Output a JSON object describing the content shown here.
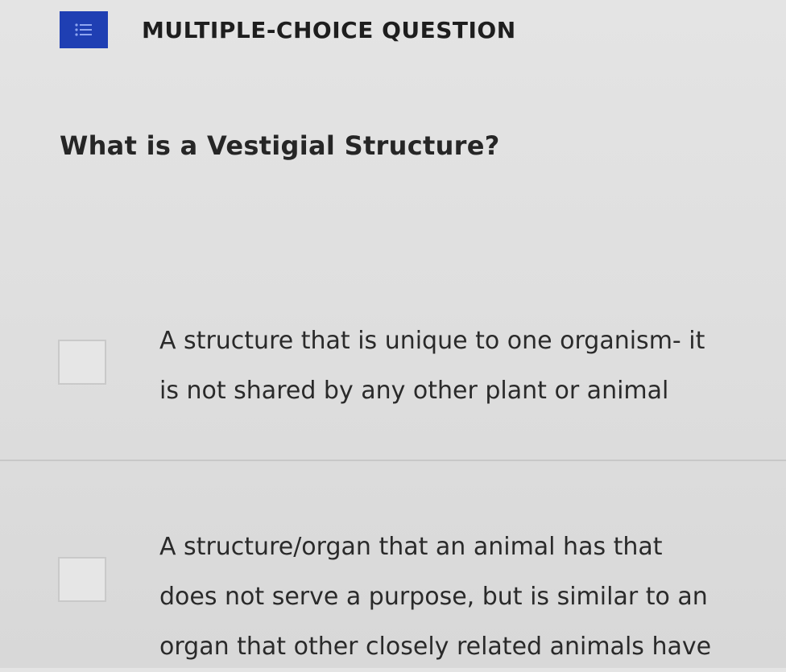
{
  "header": {
    "icon": "list-icon",
    "type_label": "MULTIPLE-CHOICE QUESTION"
  },
  "question": {
    "text": "What is a Vestigial Structure?"
  },
  "options": [
    {
      "checked": false,
      "lines": [
        "A structure that is unique to one organism- it",
        "is not shared by any other plant or animal"
      ]
    },
    {
      "checked": false,
      "lines": [
        "A structure/organ that an animal has that",
        "does not serve a purpose, but is similar to an",
        "organ that other closely related animals have"
      ]
    }
  ],
  "colors": {
    "icon_background": "#1f3fb3",
    "page_background": "#e1e1e1",
    "text": "#2b2b2b"
  }
}
